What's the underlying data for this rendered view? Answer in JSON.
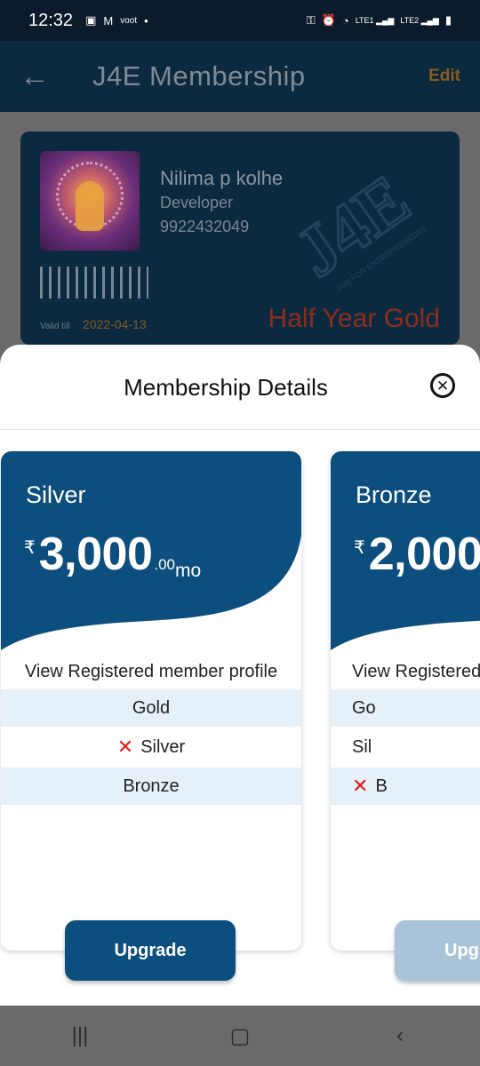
{
  "status_bar": {
    "time": "12:32",
    "left_icons": [
      "image-icon",
      "gmail-icon",
      "voot-icon",
      "dot-icon"
    ],
    "voot_label": "voot",
    "right_icons": [
      "key-icon",
      "alarm-icon",
      "wifi-icon",
      "lte1-signal-icon",
      "lte2-signal-icon",
      "battery-icon"
    ],
    "lte1": "LTE1",
    "lte2": "LTE2"
  },
  "header": {
    "title": "J4E Membership",
    "edit_label": "Edit"
  },
  "card": {
    "name": "Nilima p kolhe",
    "role": "Developer",
    "phone": "9922432049",
    "valid_label": "Valid till",
    "valid_date": "2022-04-13",
    "plan_name": "Half Year Gold",
    "watermark": "J4E",
    "watermark_tagline": "JAIN FOR ENTREPRENEURS"
  },
  "sheet": {
    "title": "Membership Details",
    "close_icon": "close-circle-icon"
  },
  "plans": [
    {
      "name": "Silver",
      "currency": "₹",
      "amount": "3,000",
      "decimals": ".00",
      "period": "mo",
      "features": [
        "View Registered member profile",
        "Gold",
        "Silver",
        "Bronze"
      ],
      "upgrade_label": "Upgrade"
    },
    {
      "name": "Bronze",
      "currency": "₹",
      "amount": "2,000",
      "features": [
        "View Registered",
        "Go",
        "Sil",
        "B"
      ],
      "upgrade_label": "Upg"
    }
  ],
  "colors": {
    "primary": "#0c4e7e",
    "highlight_row": "#e6f0f9",
    "cross": "#e21b1b",
    "disabled_button": "#a9c4d8"
  },
  "nav": {
    "recents_icon": "recents-icon",
    "home_icon": "home-icon",
    "back_icon": "back-nav-icon"
  }
}
